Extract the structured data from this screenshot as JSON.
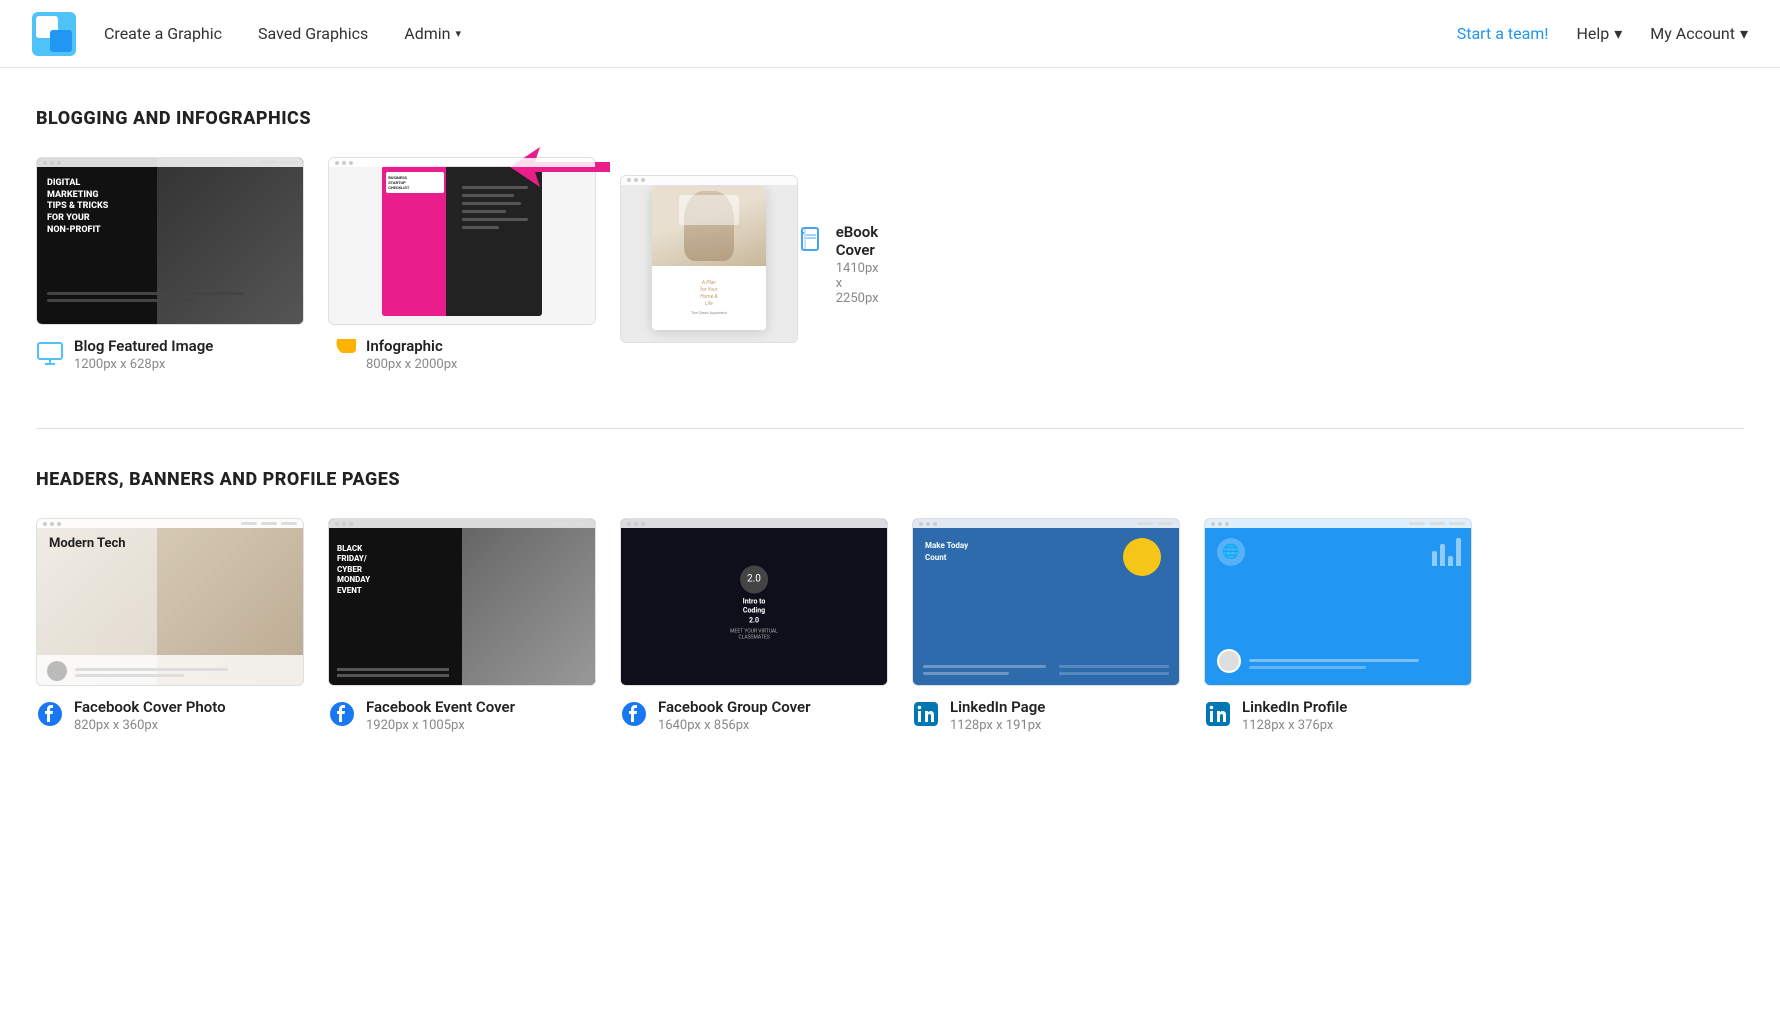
{
  "nav": {
    "create_label": "Create a Graphic",
    "saved_label": "Saved Graphics",
    "admin_label": "Admin",
    "start_team_label": "Start a team!",
    "help_label": "Help",
    "my_account_label": "My Account"
  },
  "sections": [
    {
      "id": "blogging",
      "title": "BLOGGING AND INFOGRAPHICS",
      "cards": [
        {
          "name": "Blog Featured Image",
          "dimensions": "1200px x 628px",
          "icon": "monitor",
          "preview_type": "blog"
        },
        {
          "name": "Infographic",
          "dimensions": "800px x 2000px",
          "icon": "pie",
          "preview_type": "infographic"
        },
        {
          "name": "eBook Cover",
          "dimensions": "1410px x 2250px",
          "icon": "book",
          "preview_type": "ebook",
          "has_arrow": true
        }
      ]
    },
    {
      "id": "headers",
      "title": "HEADERS, BANNERS AND PROFILE PAGES",
      "cards": [
        {
          "name": "Facebook Cover Photo",
          "dimensions": "820px x 360px",
          "icon": "facebook",
          "preview_type": "fb-cover"
        },
        {
          "name": "Facebook Event Cover",
          "dimensions": "1920px x 1005px",
          "icon": "facebook",
          "preview_type": "fb-event"
        },
        {
          "name": "Facebook Group Cover",
          "dimensions": "1640px x 856px",
          "icon": "facebook",
          "preview_type": "fb-group"
        },
        {
          "name": "LinkedIn Page",
          "dimensions": "1128px x 191px",
          "icon": "linkedin",
          "preview_type": "li-page"
        },
        {
          "name": "LinkedIn Profile",
          "dimensions": "1128px x 376px",
          "icon": "linkedin",
          "preview_type": "li-profile"
        }
      ]
    }
  ],
  "arrow": {
    "color": "#e91e8c"
  }
}
